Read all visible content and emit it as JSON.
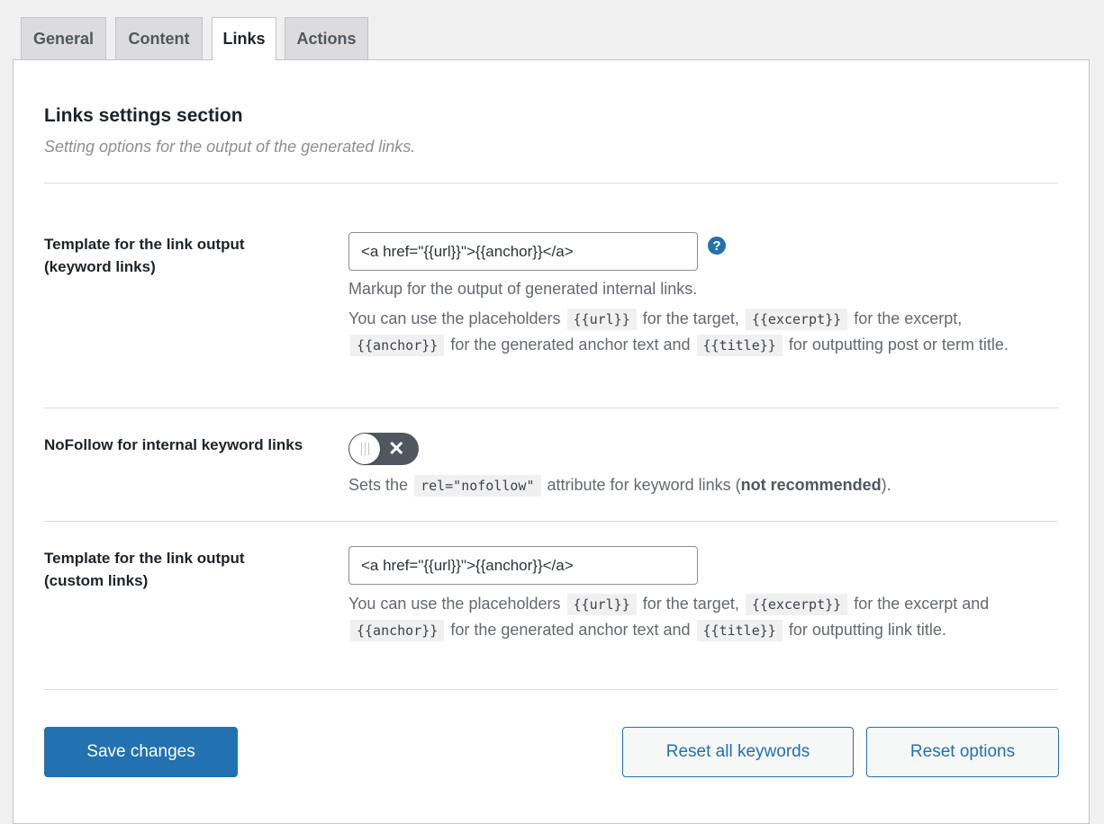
{
  "tabs": [
    "General",
    "Content",
    "Links",
    "Actions"
  ],
  "active_tab": "Links",
  "section": {
    "title": "Links settings section",
    "description": "Setting options for the output of the generated links."
  },
  "keyword_template": {
    "label": "Template for the link output (keyword links)",
    "value": "<a href=\"{{url}}\">{{anchor}}</a>",
    "help_icon": "question-mark-circle-icon",
    "desc1": "Markup for the output of generated internal links.",
    "desc2_parts": {
      "p1": "You can use the placeholders",
      "c1": "{{url}}",
      "p2": "for the target,",
      "c2": "{{excerpt}}",
      "p3": "for the excerpt,",
      "c3": "{{anchor}}",
      "p4": "for the generated anchor text and",
      "c4": "{{title}}",
      "p5": "for outputting post or term title."
    }
  },
  "nofollow": {
    "label": "NoFollow for internal keyword links",
    "enabled": false,
    "toggle_icon": "close-icon",
    "desc_p1": "Sets the",
    "desc_code": "rel=\"nofollow\"",
    "desc_p2": "attribute for keyword links (",
    "desc_bold": "not recommended",
    "desc_p3": ")."
  },
  "custom_template": {
    "label": "Template for the link output (custom links)",
    "value": "<a href=\"{{url}}\">{{anchor}}</a>",
    "desc_parts": {
      "p1": "You can use the placeholders",
      "c1": "{{url}}",
      "p2": "for the target,",
      "c2": "{{excerpt}}",
      "p3": "for the excerpt and",
      "c3": "{{anchor}}",
      "p4": "for the generated anchor text and",
      "c4": "{{title}}",
      "p5": "for outputting link title."
    }
  },
  "buttons": {
    "save": "Save changes",
    "reset_keywords": "Reset all keywords",
    "reset_options": "Reset options"
  },
  "colors": {
    "accent": "#2271b1",
    "background": "#f0f0f1",
    "toggle_off": "#50575e"
  }
}
